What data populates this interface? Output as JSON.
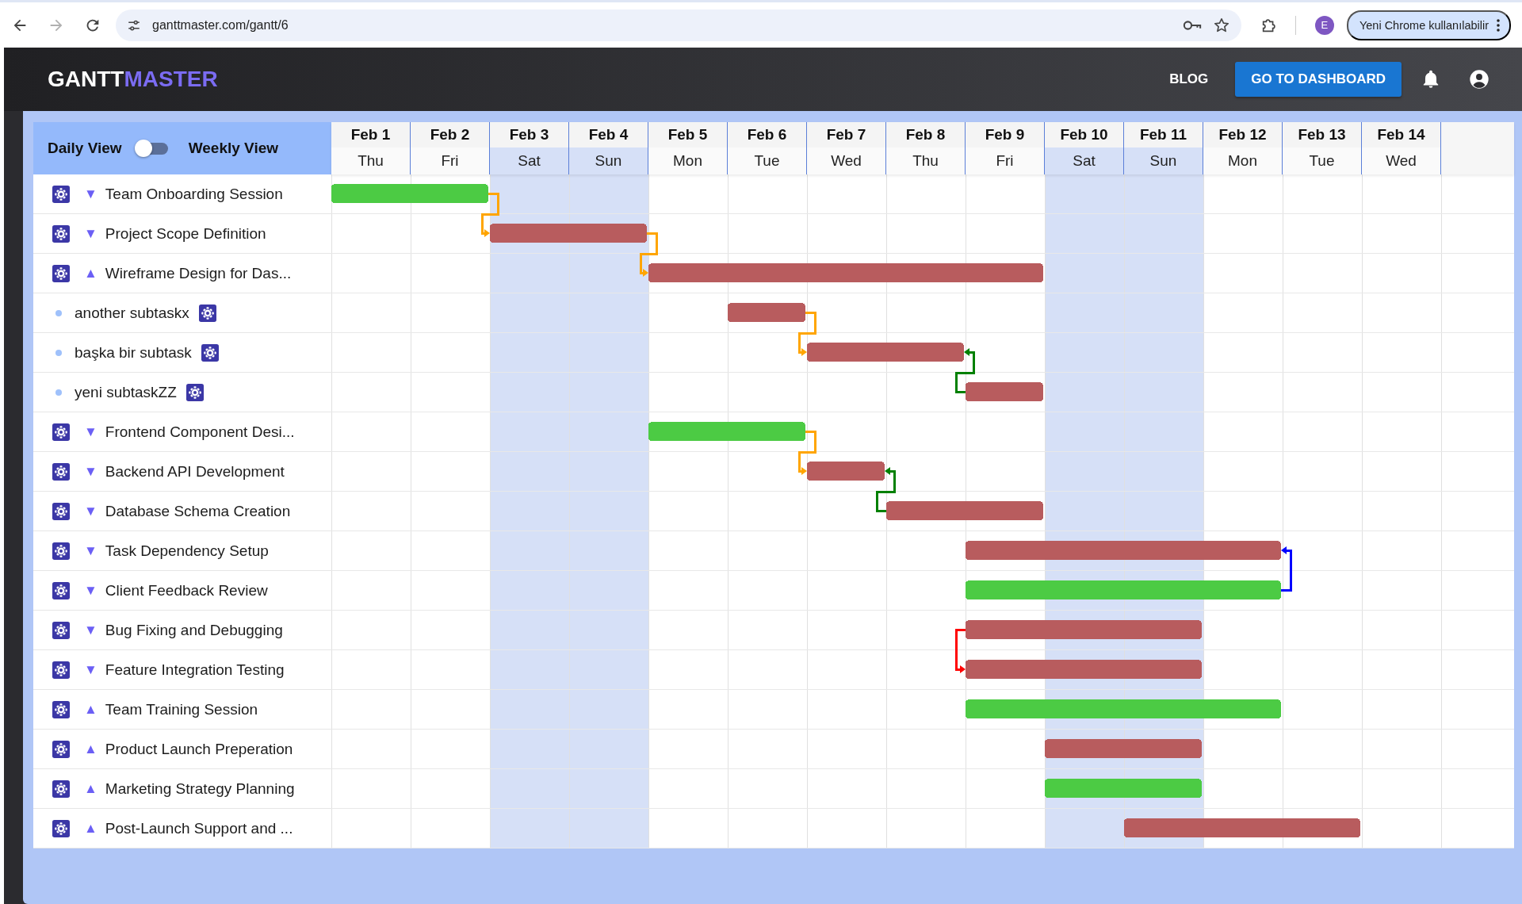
{
  "browser": {
    "url": "ganttmaster.com/gantt/6",
    "forward_disabled": true,
    "profile_initial": "E",
    "update_label": "Yeni Chrome kullanılabilir"
  },
  "header": {
    "logo_primary": "GANTT",
    "logo_accent": "MASTER",
    "links": [
      {
        "label": "BLOG",
        "kind": "text"
      },
      {
        "label": "GO TO DASHBOARD",
        "kind": "contained"
      }
    ]
  },
  "view_toggle": {
    "left_label": "Daily View",
    "right_label": "Weekly View",
    "on": false
  },
  "days": [
    {
      "date": "Feb 1",
      "weekday": "Thu",
      "weekend": false
    },
    {
      "date": "Feb 2",
      "weekday": "Fri",
      "weekend": false
    },
    {
      "date": "Feb 3",
      "weekday": "Sat",
      "weekend": true
    },
    {
      "date": "Feb 4",
      "weekday": "Sun",
      "weekend": true
    },
    {
      "date": "Feb 5",
      "weekday": "Mon",
      "weekend": false
    },
    {
      "date": "Feb 6",
      "weekday": "Tue",
      "weekend": false
    },
    {
      "date": "Feb 7",
      "weekday": "Wed",
      "weekend": false
    },
    {
      "date": "Feb 8",
      "weekday": "Thu",
      "weekend": false
    },
    {
      "date": "Feb 9",
      "weekday": "Fri",
      "weekend": false
    },
    {
      "date": "Feb 10",
      "weekday": "Sat",
      "weekend": true
    },
    {
      "date": "Feb 11",
      "weekday": "Sun",
      "weekend": true
    },
    {
      "date": "Feb 12",
      "weekday": "Mon",
      "weekend": false
    },
    {
      "date": "Feb 13",
      "weekday": "Tue",
      "weekend": false
    },
    {
      "date": "Feb 14",
      "weekday": "Wed",
      "weekend": false
    }
  ],
  "tasks": [
    {
      "name": "Team Onboarding Session",
      "marker": "▼",
      "bar": {
        "color": "#4ccb44",
        "days": [
          true,
          true,
          false,
          false,
          false,
          false,
          false,
          false,
          false,
          false,
          false,
          false,
          false,
          false
        ]
      }
    },
    {
      "name": "Project Scope Definition",
      "marker": "▼",
      "bar": {
        "color": "#b85c5e",
        "days": [
          false,
          false,
          true,
          true,
          false,
          false,
          false,
          false,
          false,
          false,
          false,
          false,
          false,
          false
        ]
      },
      "link": {
        "kind": "finish-start",
        "color": "#ffa500"
      }
    },
    {
      "name": "Wireframe Design for Das...",
      "marker": "▲",
      "bar": {
        "color": "#b85c5e",
        "days": [
          false,
          false,
          false,
          false,
          true,
          true,
          true,
          true,
          true,
          false,
          false,
          false,
          false,
          false
        ]
      },
      "link": {
        "kind": "finish-start",
        "color": "#ffa500"
      },
      "children": [
        {
          "name": "another subtaskx",
          "bar": {
            "color": "#b85c5e",
            "days": [
              false,
              false,
              false,
              false,
              false,
              true,
              false,
              false,
              false,
              false,
              false,
              false,
              false,
              false
            ]
          }
        },
        {
          "name": "başka bir subtask",
          "bar": {
            "color": "#b85c5e",
            "days": [
              false,
              false,
              false,
              false,
              false,
              false,
              true,
              true,
              false,
              false,
              false,
              false,
              false,
              false
            ]
          },
          "link": {
            "kind": "finish-start",
            "color": "#ffa500"
          }
        },
        {
          "name": "yeni subtaskZZ",
          "bar": {
            "color": "#b85c5e",
            "days": [
              false,
              false,
              false,
              false,
              false,
              false,
              false,
              false,
              true,
              false,
              false,
              false,
              false,
              false
            ]
          },
          "link": {
            "kind": "start-finish",
            "color": "#008000"
          }
        }
      ]
    },
    {
      "name": "Frontend Component Desi...",
      "marker": "▼",
      "bar": {
        "color": "#4ccb44",
        "days": [
          false,
          false,
          false,
          false,
          true,
          true,
          false,
          false,
          false,
          false,
          false,
          false,
          false,
          false
        ]
      }
    },
    {
      "name": "Backend API Development",
      "marker": "▼",
      "bar": {
        "color": "#b85c5e",
        "days": [
          false,
          false,
          false,
          false,
          false,
          false,
          true,
          false,
          false,
          false,
          false,
          false,
          false,
          false
        ]
      },
      "link": {
        "kind": "finish-start",
        "color": "#ffa500"
      }
    },
    {
      "name": "Database Schema Creation",
      "marker": "▼",
      "bar": {
        "color": "#b85c5e",
        "days": [
          false,
          false,
          false,
          false,
          false,
          false,
          false,
          true,
          true,
          false,
          false,
          false,
          false,
          false
        ]
      },
      "link": {
        "kind": "start-finish",
        "color": "#008000"
      }
    },
    {
      "name": "Task Dependency Setup",
      "marker": "▼",
      "bar": {
        "color": "#b85c5e",
        "days": [
          false,
          false,
          false,
          false,
          false,
          false,
          false,
          false,
          true,
          true,
          true,
          true,
          false,
          false
        ]
      }
    },
    {
      "name": "Client Feedback Review",
      "marker": "▼",
      "bar": {
        "color": "#4ccb44",
        "days": [
          false,
          false,
          false,
          false,
          false,
          false,
          false,
          false,
          true,
          true,
          true,
          true,
          false,
          false
        ]
      },
      "link": {
        "kind": "finish-finish",
        "color": "#0000ff"
      }
    },
    {
      "name": "Bug Fixing and Debugging",
      "marker": "▼",
      "bar": {
        "color": "#b85c5e",
        "days": [
          false,
          false,
          false,
          false,
          false,
          false,
          false,
          false,
          true,
          true,
          true,
          false,
          false,
          false
        ]
      }
    },
    {
      "name": "Feature Integration Testing",
      "marker": "▼",
      "bar": {
        "color": "#b85c5e",
        "days": [
          false,
          false,
          false,
          false,
          false,
          false,
          false,
          false,
          true,
          true,
          true,
          false,
          false,
          false
        ]
      },
      "link": {
        "kind": "start-start",
        "color": "#ff0000"
      }
    },
    {
      "name": "Team Training Session",
      "marker": "▲",
      "bar": {
        "color": "#4ccb44",
        "days": [
          false,
          false,
          false,
          false,
          false,
          false,
          false,
          false,
          true,
          true,
          true,
          true,
          false,
          false
        ]
      }
    },
    {
      "name": "Product Launch Preperation",
      "marker": "▲",
      "bar": {
        "color": "#b85c5e",
        "days": [
          false,
          false,
          false,
          false,
          false,
          false,
          false,
          false,
          false,
          true,
          true,
          false,
          false,
          false
        ]
      }
    },
    {
      "name": "Marketing Strategy Planning",
      "marker": "▲",
      "bar": {
        "color": "#4ccb44",
        "days": [
          false,
          false,
          false,
          false,
          false,
          false,
          false,
          false,
          false,
          true,
          true,
          false,
          false,
          false
        ]
      }
    },
    {
      "name": "Post-Launch Support and ...",
      "marker": "▲",
      "bar": {
        "color": "#b85c5e",
        "days": [
          false,
          false,
          false,
          false,
          false,
          false,
          false,
          false,
          false,
          false,
          true,
          true,
          true,
          false
        ]
      }
    }
  ]
}
